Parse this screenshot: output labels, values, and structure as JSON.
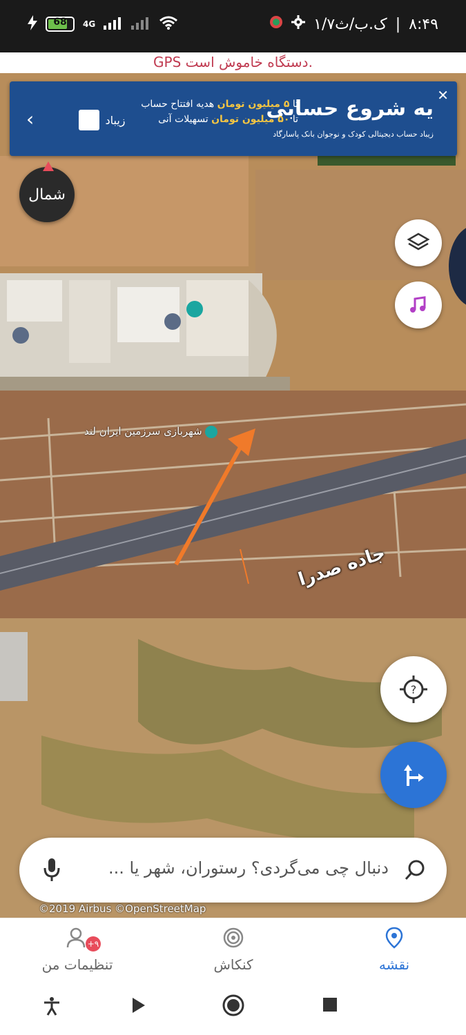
{
  "status_bar": {
    "time": "۸:۴۹",
    "speed": "۱/۷ک.ب/ث",
    "battery": "68",
    "network": "4G"
  },
  "gps_warning": "GPS دستگاه خاموش است.",
  "ad": {
    "title": "یه شروع حسابی",
    "line1_a": "تا",
    "line1_amount": "۵ میلیون تومان",
    "line1_b": "هدیه افتتاح حساب",
    "line2_a": "تا",
    "line2_amount": "۵۰ میلیون تومان",
    "line2_b": "تسهیلات آنی",
    "small": "زیباد حساب دیجیتالی کودک و نوجوان بانک پاسارگاد",
    "brand": "زیباد"
  },
  "north_label": "شمال",
  "map": {
    "road_label": "جاده صدرا",
    "poi_label": "شهربازی سرزمین ایران لند",
    "attribution": "©2019 Airbus ©OpenStreetMap"
  },
  "search": {
    "placeholder": "دنبال چی می‌گردی؟ رستوران، شهر یا ..."
  },
  "bottom_nav": {
    "items": [
      {
        "label": "نقشه",
        "icon": "map-pin-icon",
        "active": true
      },
      {
        "label": "کنکاش",
        "icon": "explore-icon",
        "active": false
      },
      {
        "label": "تنظیمات من",
        "icon": "profile-icon",
        "active": false,
        "badge": "+۹"
      }
    ]
  },
  "colors": {
    "accent": "#2c74d6",
    "warning": "#c03b51",
    "ad_bg": "#1e4e8f",
    "music": "#b23fc6"
  }
}
